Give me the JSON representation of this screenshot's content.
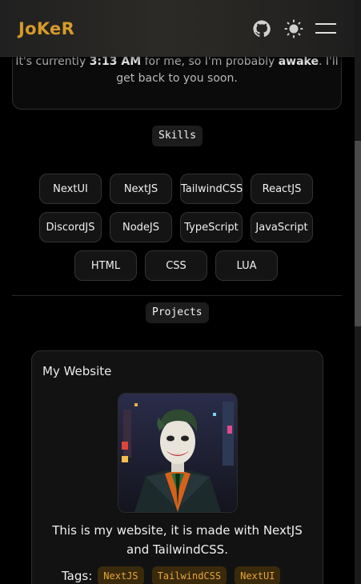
{
  "navbar": {
    "brand": "JoKeR",
    "icons": [
      "github-icon",
      "theme-toggle-icon",
      "menu-icon"
    ]
  },
  "about": {
    "text_parts": [
      "It's currently ",
      "3:13 AM",
      " for me, so I'm probably ",
      "awake",
      ". I'll get back to you soon."
    ]
  },
  "skills": {
    "label": "Skills",
    "items": [
      "NextUI",
      "NextJS",
      "TailwindCSS",
      "ReactJS",
      "DiscordJS",
      "NodeJS",
      "TypeScript",
      "JavaScript",
      "HTML",
      "CSS",
      "LUA"
    ]
  },
  "projects": {
    "label": "Projects",
    "items": [
      {
        "title": "My Website",
        "image_alt": "joker-illustration",
        "description": "This is my website, it is made with NextJS and TailwindCSS.",
        "tags_label": "Tags:",
        "tags": [
          "NextJS",
          "TailwindCSS",
          "NextUI"
        ]
      }
    ]
  },
  "colors": {
    "brand": "#d69a2a",
    "tag_text": "#e6a53a",
    "tag_bg": "#3a2a0c",
    "background": "#000000"
  }
}
